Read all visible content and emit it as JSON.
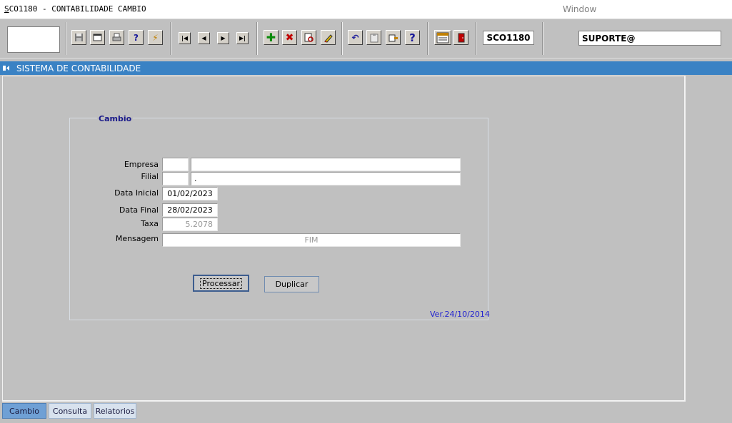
{
  "app": {
    "title_prefix": "S",
    "title_rest": "CO1180 - CONTABILIDADE CAMBIO",
    "window_menu": "Window"
  },
  "toolbar": {
    "module_code": "SCO1180",
    "user": "SUPORTE@",
    "buttons": [
      "save-icon",
      "window-icon",
      "print-icon",
      "help-query-icon",
      "execute-query-icon",
      "first-record-icon",
      "previous-record-icon",
      "next-record-icon",
      "last-record-icon",
      "insert-record-icon",
      "delete-record-icon",
      "search-record-icon",
      "clear-record-icon",
      "undo-icon",
      "clipboard-icon",
      "list-values-icon",
      "help-icon",
      "menu-icon",
      "exit-icon"
    ]
  },
  "window": {
    "title": "SISTEMA DE CONTABILIDADE"
  },
  "form": {
    "group_title": "Cambio",
    "empresa_label": "Empresa",
    "empresa_code": "",
    "empresa_name": "",
    "filial_label": "Filial",
    "filial_code": "",
    "filial_name": ".",
    "data_inicial_label": "Data Inicial",
    "data_inicial": "01/02/2023",
    "data_final_label": "Data Final",
    "data_final": "28/02/2023",
    "taxa_label": "Taxa",
    "taxa": "5.2078",
    "mensagem_label": "Mensagem",
    "mensagem": "FIM",
    "processar_label": "Processar",
    "duplicar_label": "Duplicar",
    "version": "Ver.24/10/2014"
  },
  "tabs": [
    "Cambio",
    "Consulta",
    "Relatorios"
  ],
  "colors": {
    "titlebar": "#3a82c4",
    "active_tab": "#6fa0d5",
    "version_text": "#2020d0",
    "group_title": "#1a1a8a"
  }
}
